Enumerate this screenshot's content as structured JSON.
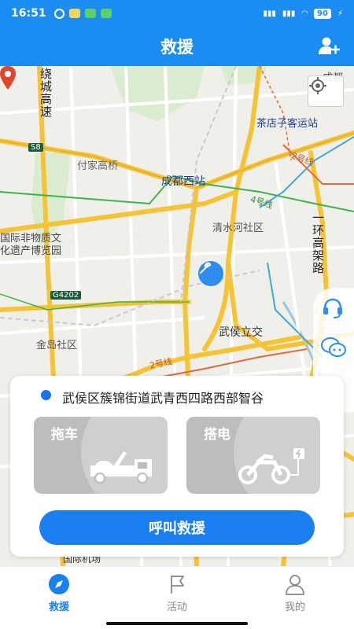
{
  "status": {
    "time": "16:51",
    "battery": "90"
  },
  "header": {
    "title": "救援"
  },
  "map": {
    "labels": {
      "raocheng": "绕城高速",
      "chadian": "茶店子客运站",
      "fujia": "付家高桥",
      "chengdu_west": "成都西站",
      "line4": "4号线",
      "qingshui": "清水河社区",
      "yihuan": "一环高架路",
      "heritage1": "国际非物质文",
      "heritage2": "化遗产博览园",
      "g4202": "G4202",
      "s8": "S8",
      "line2": "2号线",
      "line2b": "2号线",
      "jindao": "金岛社区",
      "wuhou": "武侯立交",
      "airport": "国际机场",
      "chengdu_corner": "成都"
    }
  },
  "card": {
    "address": "武侯区簇锦街道武青西四路西部智谷",
    "services": [
      {
        "label": "拖车"
      },
      {
        "label": "搭电"
      }
    ],
    "call_button": "呼叫救援"
  },
  "tabs": [
    {
      "label": "救援"
    },
    {
      "label": "活动"
    },
    {
      "label": "我的"
    }
  ],
  "colors": {
    "brand": "#1a8cf2",
    "accent": "#1a7ff0"
  }
}
